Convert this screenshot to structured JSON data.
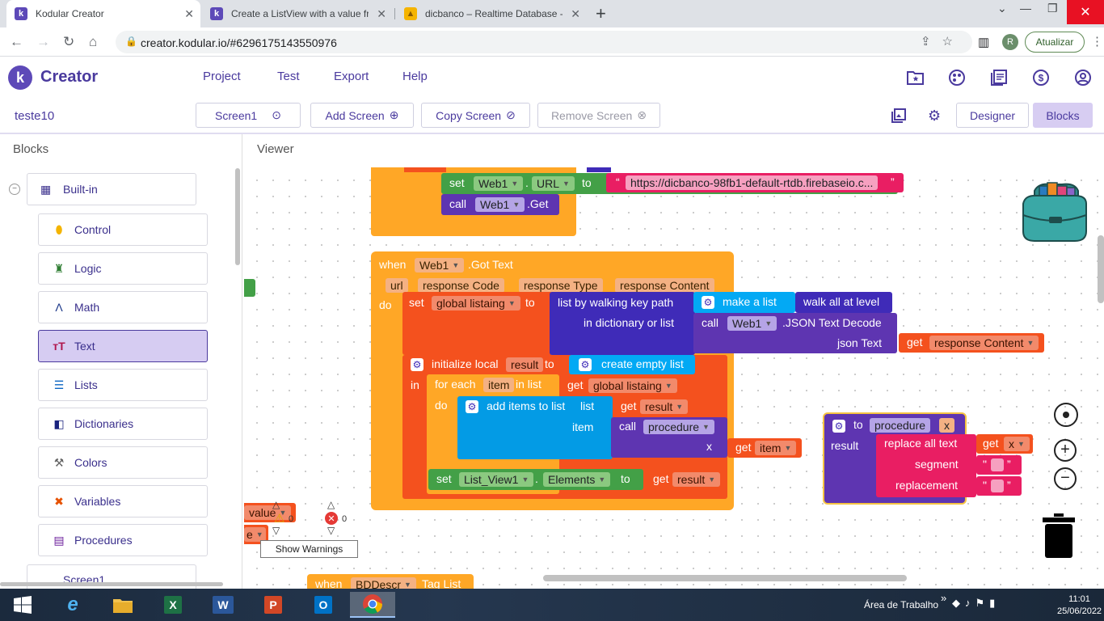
{
  "browser": {
    "tabs": [
      {
        "title": "Kodular Creator",
        "favicon": "kodular-favicon",
        "active": true
      },
      {
        "title": "Create a ListView with a value fro",
        "favicon": "kodular-favicon",
        "active": false
      },
      {
        "title": "dicbanco – Realtime Database - (",
        "favicon": "firebase-favicon",
        "active": false
      }
    ],
    "new_tab": "+",
    "url": "creator.kodular.io/#6296175143550976",
    "profile_initial": "R",
    "update_label": "Atualizar"
  },
  "app": {
    "brand": "Creator",
    "logo_letter": "k",
    "menu": [
      "Project",
      "Test",
      "Export",
      "Help"
    ],
    "colors": {
      "brand": "#4a3a9e",
      "selected": "#d6ccf2"
    }
  },
  "project_bar": {
    "project_name": "teste10",
    "screen_selector": "Screen1",
    "add_screen": "Add Screen",
    "copy_screen": "Copy Screen",
    "remove_screen": "Remove Screen",
    "designer": "Designer",
    "blocks": "Blocks"
  },
  "left_panel": {
    "title": "Blocks",
    "builtin": "Built-in",
    "categories": [
      {
        "label": "Control",
        "icon": "control-icon",
        "color": "#f4b400"
      },
      {
        "label": "Logic",
        "icon": "logic-icon",
        "color": "#2e7d32"
      },
      {
        "label": "Math",
        "icon": "math-icon",
        "color": "#1e3a8a"
      },
      {
        "label": "Text",
        "icon": "text-icon",
        "color": "#b0174e",
        "selected": true
      },
      {
        "label": "Lists",
        "icon": "lists-icon",
        "color": "#0b66c3"
      },
      {
        "label": "Dictionaries",
        "icon": "dictionaries-icon",
        "color": "#1a237e"
      },
      {
        "label": "Colors",
        "icon": "colors-icon",
        "color": "#616161"
      },
      {
        "label": "Variables",
        "icon": "variables-icon",
        "color": "#e65100"
      },
      {
        "label": "Procedures",
        "icon": "procedures-icon",
        "color": "#6a1b9a"
      }
    ],
    "screen_node": "Screen1"
  },
  "viewer": {
    "title": "Viewer",
    "blocks": {
      "top_set_url": {
        "set": "set",
        "component": "Web1",
        "dot": ".",
        "property": "URL",
        "to": "to",
        "url_text": "https://dicbanco-98fb1-default-rtdb.firebaseio.c..."
      },
      "top_call_get": {
        "call": "call",
        "component": "Web1",
        "method": ".Get"
      },
      "when_got_text": {
        "when": "when",
        "component": "Web1",
        "event": ".Got Text",
        "params": [
          "url",
          "response Code",
          "response Type",
          "response Content"
        ],
        "do": "do"
      },
      "set_global": {
        "set": "set",
        "var": "global listaing",
        "to": "to"
      },
      "list_by_walking": {
        "label": "list by walking key path",
        "in_dict": "in dictionary or list"
      },
      "make_a_list": "make a list",
      "walk_all": "walk all at level",
      "call_json": {
        "call": "call",
        "component": "Web1",
        "method": ".JSON Text Decode",
        "arg": "json Text"
      },
      "get_response_content": {
        "get": "get",
        "var": "response Content"
      },
      "init_local": {
        "label": "initialize local",
        "var": "result",
        "to": "to",
        "in": "in"
      },
      "create_empty_list": "create empty list",
      "for_each": {
        "label": "for each",
        "var": "item",
        "in_list": "in list",
        "do": "do"
      },
      "get_global_listaing": {
        "get": "get",
        "var": "global listaing"
      },
      "add_items": {
        "label": "add items to list",
        "list": "list",
        "item": "item"
      },
      "get_result_1": {
        "get": "get",
        "var": "result"
      },
      "call_procedure": {
        "call": "call",
        "name": "procedure",
        "arg": "x"
      },
      "get_item": {
        "get": "get",
        "var": "item"
      },
      "set_list_view": {
        "set": "set",
        "component": "List_View1",
        "dot": ".",
        "property": "Elements",
        "to": "to"
      },
      "get_result_2": {
        "get": "get",
        "var": "result"
      },
      "procedure_def": {
        "to": "to",
        "name": "procedure",
        "param": "x",
        "result": "result"
      },
      "replace_all": {
        "label": "replace all text",
        "segment": "segment",
        "replacement": "replacement"
      },
      "get_x": {
        "get": "get",
        "var": "x"
      },
      "text_segment": "\"",
      "text_replacement": "\"",
      "partial_value": "value",
      "partial_e": "e",
      "partial_bottom": {
        "when": "when",
        "component": "BDDescr",
        "event": "Tag List"
      }
    },
    "warnings": {
      "warning_count": "0",
      "error_count": "0",
      "show_warnings": "Show Warnings"
    }
  },
  "taskbar": {
    "tray_label": "Área de Trabalho",
    "tray_chevron": "»",
    "time": "11:01",
    "date": "25/06/2022"
  }
}
